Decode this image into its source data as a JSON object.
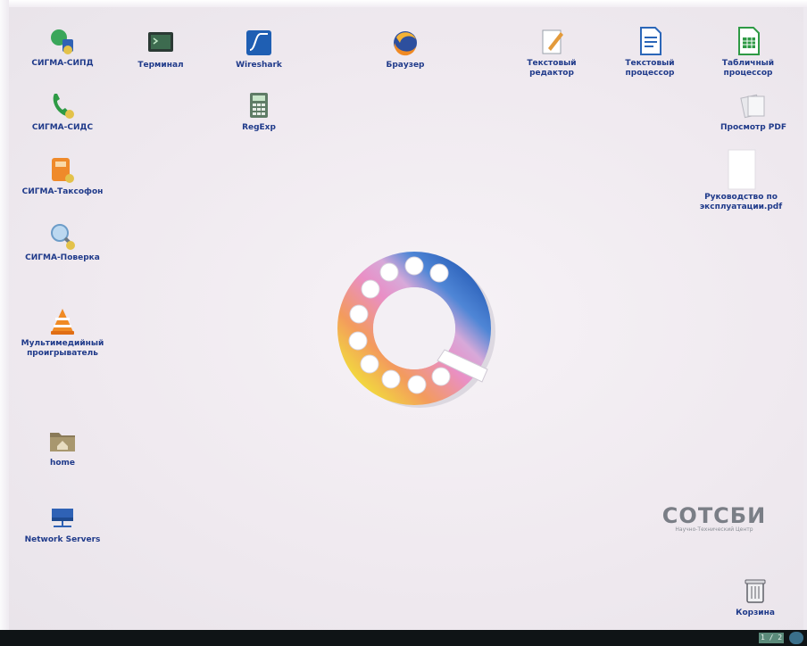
{
  "desktop": {
    "icons": [
      {
        "label": "СИГМА-СИПД",
        "icon": "network-plug-icon"
      },
      {
        "label": "Терминал",
        "icon": "terminal-icon"
      },
      {
        "label": "Wireshark",
        "icon": "wireshark-icon"
      },
      {
        "label": "Браузер",
        "icon": "firefox-icon"
      },
      {
        "label": "Текстовый\nредактор",
        "icon": "text-editor-icon"
      },
      {
        "label": "Текстовый\nпроцессор",
        "icon": "writer-icon"
      },
      {
        "label": "Табличный\nпроцессор",
        "icon": "calc-icon"
      },
      {
        "label": "СИГМА-СИДС",
        "icon": "phone-icon"
      },
      {
        "label": "RegExp",
        "icon": "calculator-icon"
      },
      {
        "label": "Просмотр PDF",
        "icon": "pdf-viewer-icon"
      },
      {
        "label": "СИГМА-Таксофон",
        "icon": "payphone-icon"
      },
      {
        "label": "Руководство по\nэксплуатации.pdf",
        "icon": "pdf-file-icon"
      },
      {
        "label": "СИГМА-Поверка",
        "icon": "magnifier-icon"
      },
      {
        "label": "Мультимедийный\nпроигрыватель",
        "icon": "vlc-icon"
      },
      {
        "label": "home",
        "icon": "home-folder-icon"
      },
      {
        "label": "Network Servers",
        "icon": "network-servers-icon"
      },
      {
        "label": "Корзина",
        "icon": "trash-icon"
      }
    ]
  },
  "branding": {
    "name": "СОТСБИ",
    "subtitle": "Научно-Технический Центр"
  },
  "taskbar": {
    "pager": "1 / 2"
  }
}
